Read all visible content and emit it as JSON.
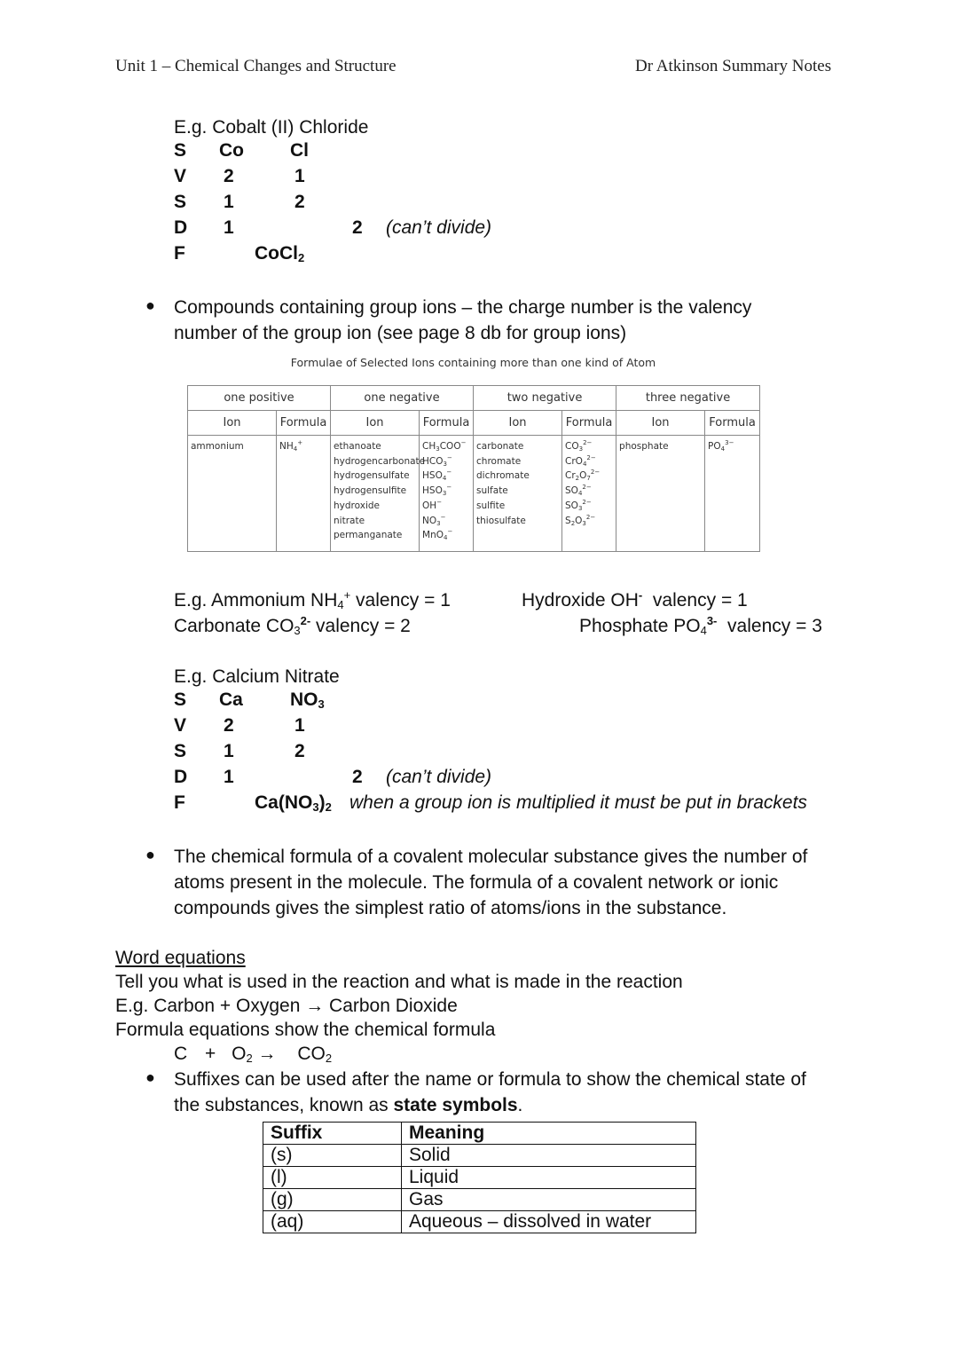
{
  "header": {
    "left": "Unit 1 – Chemical Changes and Structure",
    "right": "Dr Atkinson Summary Notes"
  },
  "example1": {
    "title": "E.g. Cobalt (II) Chloride",
    "rows": [
      {
        "letter": "S",
        "a": "Co",
        "b": "Cl"
      },
      {
        "letter": "V",
        "a": "2",
        "b": "1"
      },
      {
        "letter": "S",
        "a": "1",
        "b": "2"
      },
      {
        "letter": "D",
        "a": "1",
        "c": "2",
        "note": "(can’t divide)"
      },
      {
        "letter": "F",
        "formula": "CoCl",
        "formula_sub": "2"
      }
    ]
  },
  "bullet1": {
    "line1": "Compounds containing group ions – the charge number is the valency",
    "line2": "number of the group ion (see page 8 db for group ions)"
  },
  "ion_table": {
    "title": "Formulae of Selected Ions containing more than one kind of Atom",
    "groups": [
      "one positive",
      "one negative",
      "two negative",
      "three negative"
    ],
    "col_ion": "Ion",
    "col_formula": "Formula",
    "one_positive": [
      {
        "ion": "ammonium",
        "base": "NH",
        "sub": "4",
        "charge": "+"
      }
    ],
    "one_negative": [
      {
        "ion": "ethanoate",
        "base": "CH",
        "sub": "3",
        "tail": "COO",
        "charge": "−"
      },
      {
        "ion": "hydrogencarbonate",
        "base": "HCO",
        "sub": "3",
        "charge": "−"
      },
      {
        "ion": "hydrogensulfate",
        "base": "HSO",
        "sub": "4",
        "charge": "−"
      },
      {
        "ion": "hydrogensulfite",
        "base": "HSO",
        "sub": "3",
        "charge": "−"
      },
      {
        "ion": "hydroxide",
        "base": "OH",
        "sub": "",
        "charge": "−"
      },
      {
        "ion": "nitrate",
        "base": "NO",
        "sub": "3",
        "charge": "−"
      },
      {
        "ion": "permanganate",
        "base": "MnO",
        "sub": "4",
        "charge": "−"
      }
    ],
    "two_negative": [
      {
        "ion": "carbonate",
        "base": "CO",
        "sub": "3",
        "charge": "2−"
      },
      {
        "ion": "chromate",
        "base": "CrO",
        "sub": "4",
        "charge": "2−"
      },
      {
        "ion": "dichromate",
        "base": "Cr",
        "sub": "2",
        "tail": "O",
        "sub2": "7",
        "charge": "2−"
      },
      {
        "ion": "sulfate",
        "base": "SO",
        "sub": "4",
        "charge": "2−"
      },
      {
        "ion": "sulfite",
        "base": "SO",
        "sub": "3",
        "charge": "2−"
      },
      {
        "ion": "thiosulfate",
        "base": "S",
        "sub": "2",
        "tail": "O",
        "sub2": "3",
        "charge": "2−"
      }
    ],
    "three_negative": [
      {
        "ion": "phosphate",
        "base": "PO",
        "sub": "4",
        "charge": "3−"
      }
    ]
  },
  "valency_examples": {
    "ammonium": {
      "pre": "E.g. Ammonium NH",
      "sub": "4",
      "sup": "+",
      "post": " valency = 1"
    },
    "hydroxide": {
      "pre": "Hydroxide OH",
      "sup": "-",
      "post": "  valency = 1"
    },
    "carbonate": {
      "pre": "Carbonate CO",
      "sub": "3",
      "sup": "2-",
      "post": " valency = 2"
    },
    "phosphate": {
      "pre": "Phosphate PO",
      "sub": "4",
      "sup": "3-",
      "post": "  valency = 3"
    }
  },
  "example2": {
    "title": "E.g. Calcium Nitrate",
    "rows": [
      {
        "letter": "S",
        "a": "Ca",
        "b": "NO",
        "b_sub": "3"
      },
      {
        "letter": "V",
        "a": "2",
        "b": "1"
      },
      {
        "letter": "S",
        "a": "1",
        "b": "2"
      },
      {
        "letter": "D",
        "a": "1",
        "c": "2",
        "note": "(can’t divide)"
      },
      {
        "letter": "F",
        "formula": "Ca(NO",
        "formula_sub": "3",
        "formula_close": ")",
        "formula_sub2": "2",
        "note": "when a group ion is multiplied it must be put in brackets"
      }
    ]
  },
  "bullet2": {
    "line1": "The chemical formula of a covalent molecular substance gives the number of",
    "line2": "atoms present in the molecule. The formula of a covalent network or ionic",
    "line3": "compounds gives the simplest ratio of atoms/ions in the substance."
  },
  "word_equations": {
    "heading": "Word equations",
    "line1": "Tell you what is used in the reaction and what is made in the reaction",
    "line2": "E.g. Carbon + Oxygen → Carbon Dioxide",
    "line3": "Formula equations show the chemical formula",
    "eq": {
      "c": "C",
      "plus": "+",
      "o2": "O",
      "o2_sub": "2",
      "arrow": "→",
      "co2": "CO",
      "co2_sub": "2"
    }
  },
  "bullet3": {
    "line1": "Suffixes can be used after the name or formula to show the chemical state of",
    "line2_pre": "the substances, known as ",
    "line2_bold": "state symbols",
    "line2_post": "."
  },
  "state_table": {
    "headers": [
      "Suffix",
      "Meaning"
    ],
    "rows": [
      [
        "(s)",
        "Solid"
      ],
      [
        "(l)",
        "Liquid"
      ],
      [
        "(g)",
        "Gas"
      ],
      [
        "(aq)",
        "Aqueous – dissolved in water"
      ]
    ]
  }
}
